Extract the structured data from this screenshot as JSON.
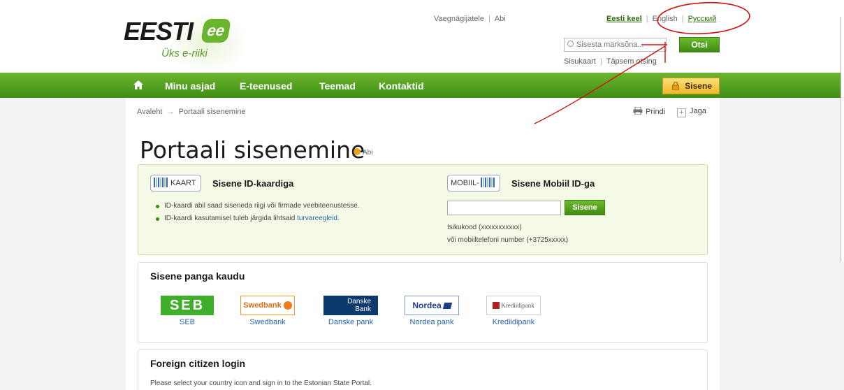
{
  "header": {
    "logo_text": "EESTI",
    "logo_badge": "ee",
    "logo_sub": "Üks e-riiki",
    "top_links": [
      "Vaegnägijatele",
      "Abi"
    ],
    "languages": [
      "Eesti keel",
      "English",
      "Русский"
    ],
    "search": {
      "placeholder": "Sisesta märksõna...",
      "button": "Otsi"
    },
    "search_links": [
      "Sisukaart",
      "Täpsem otsing"
    ]
  },
  "nav": {
    "items": [
      "Minu asjad",
      "E-teenused",
      "Teemad",
      "Kontaktid"
    ],
    "login": "Sisene"
  },
  "breadcrumb": {
    "home": "Avaleht",
    "arrow": "→",
    "current": "Portaali sisenemine"
  },
  "tools": {
    "print": "Prindi",
    "share": "Jaga",
    "share_symbol": "+"
  },
  "page": {
    "title": "Portaali sisenemine",
    "help": "Abi"
  },
  "id_card": {
    "chip": "KAART",
    "heading": "Sisene ID-kaardiga",
    "bullet1": "ID-kaardi abil saad siseneda riigi või firmade veebiteenustesse.",
    "bullet2_text": "ID-kaardi kasutamisel tuleb järgida lihtsaid ",
    "bullet2_link": "turvareegleid",
    "bullet2_end": "."
  },
  "mobile_id": {
    "chip": "MOBIIL-",
    "heading": "Sisene Mobiil ID-ga",
    "button": "Sisene",
    "hint1": "Isikukood (xxxxxxxxxxx)",
    "hint2": "või mobiiltelefoni number (+3725xxxxx)"
  },
  "banks": {
    "title": "Sisene panga kaudu",
    "items": [
      {
        "logo": "SEB",
        "label": "SEB"
      },
      {
        "logo": "Swedbank",
        "label": "Swedbank"
      },
      {
        "logo1": "Danske",
        "logo2": "Bank",
        "label": "Danske pank"
      },
      {
        "logo": "Nordea",
        "label": "Nordea pank"
      },
      {
        "logo": "Krediidipank",
        "label": "Krediidipank"
      }
    ]
  },
  "foreign": {
    "title": "Foreign citizen login",
    "text": "Please select your country icon and sign in to the Estonian State Portal."
  },
  "colors": {
    "brand_green": "#4a9a1c",
    "login_yellow": "#f5c842",
    "annotation_red": "#d01010"
  }
}
